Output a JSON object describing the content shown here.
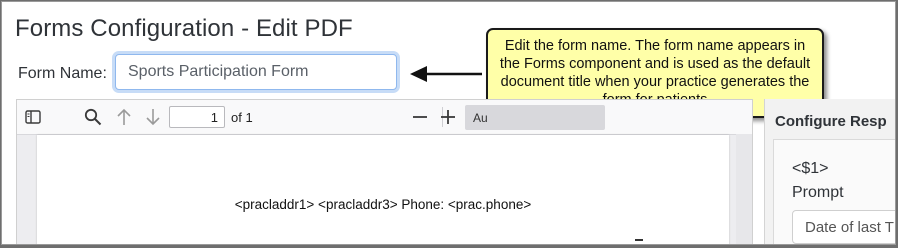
{
  "page": {
    "title": "Forms Configuration - Edit PDF"
  },
  "form": {
    "name_label": "Form Name:",
    "name_value": "Sports Participation Form"
  },
  "callout": {
    "text": "Edit the form name. The form name appears in the Forms component and is used as the default document title when your practice generates the form for patients"
  },
  "viewer": {
    "toolbar": {
      "page_number": "1",
      "page_count_text": "of 1",
      "zoom_value": "Au"
    },
    "page_text": "<pracladdr1> <pracladdr3> Phone: <prac.phone>"
  },
  "right_panel": {
    "header": "Configure Resp",
    "field_name": "<$1>",
    "prompt_label": "Prompt",
    "prompt_value": "Date of last T"
  },
  "colors": {
    "callout_bg": "#ffffa8",
    "focus_ring": "#c7dcf7",
    "title_text": "#2f3338"
  },
  "icons": [
    "sidebar-toggle-icon",
    "search-icon",
    "arrow-up-icon",
    "arrow-down-icon",
    "zoom-out-icon",
    "zoom-in-icon",
    "left-arrow-icon"
  ]
}
